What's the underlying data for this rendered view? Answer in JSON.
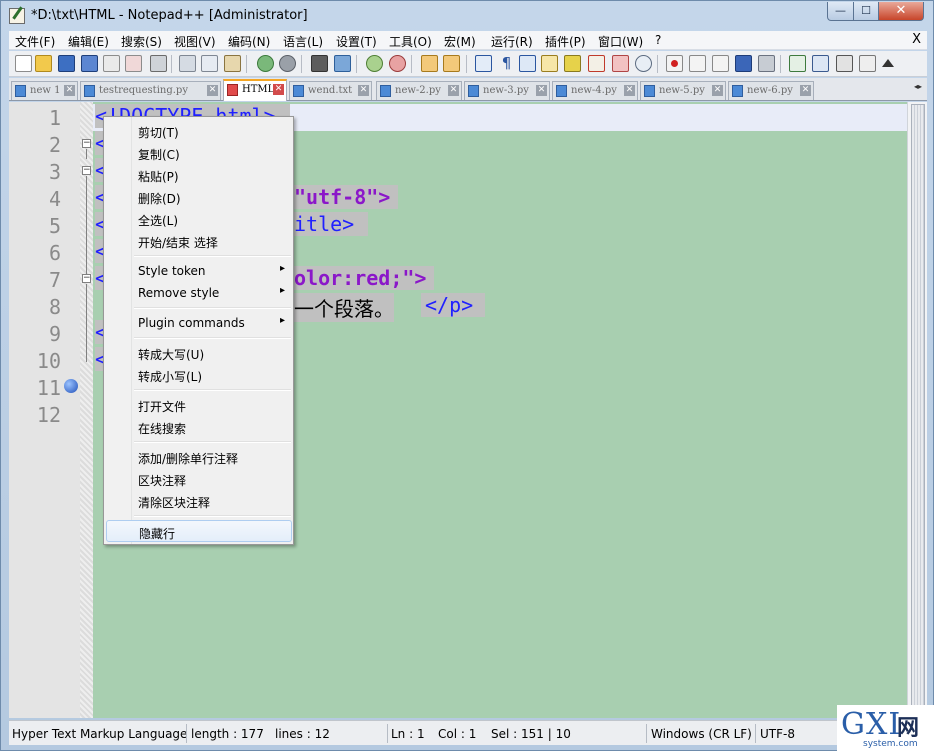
{
  "window": {
    "title": "*D:\\txt\\HTML - Notepad++ [Administrator]",
    "min_glyph": "—",
    "max_glyph": "☐",
    "close_glyph": "✕"
  },
  "menubar": {
    "items": [
      "文件(F)",
      "编辑(E)",
      "搜索(S)",
      "视图(V)",
      "编码(N)",
      "语言(L)",
      "设置(T)",
      "工具(O)",
      "宏(M)",
      "运行(R)",
      "插件(P)",
      "窗口(W)",
      "?"
    ],
    "close": "X"
  },
  "toolbar": {
    "icons": [
      "new-file-icon",
      "open-file-icon",
      "save-icon",
      "save-all-icon",
      "close-icon",
      "close-all-icon",
      "print-icon",
      "cut-icon",
      "copy-icon",
      "paste-icon",
      "undo-icon",
      "redo-icon",
      "find-icon",
      "replace-icon",
      "zoom-in-icon",
      "zoom-out-icon",
      "sync-vertical-icon",
      "sync-horizontal-icon",
      "word-wrap-icon",
      "show-all-chars-icon",
      "indent-guide-icon",
      "user-lang-icon",
      "doc-map-icon",
      "function-list-icon",
      "folder-icon",
      "monitor-icon",
      "record-macro-icon",
      "stop-record-icon",
      "play-macro-icon",
      "run-macro-multiple-icon",
      "save-macro-icon",
      "plugin-a-icon",
      "plugin-b-icon",
      "plugin-c-icon",
      "plugin-d-icon",
      "toolbar-up-icon"
    ]
  },
  "tabs": [
    {
      "label": "new 1",
      "active": false
    },
    {
      "label": "testrequesting.py",
      "active": false
    },
    {
      "label": "HTML",
      "active": true
    },
    {
      "label": "wend.txt",
      "active": false
    },
    {
      "label": "new-2.py",
      "active": false
    },
    {
      "label": "new-3.py",
      "active": false
    },
    {
      "label": "new-4.py",
      "active": false
    },
    {
      "label": "new-5.py",
      "active": false
    },
    {
      "label": "new-6.py",
      "active": false
    }
  ],
  "tab_close_glyph": "✕",
  "tab_scroll_glyph": "◂▸",
  "editor": {
    "line_numbers": [
      "1",
      "2",
      "3",
      "4",
      "5",
      "6",
      "7",
      "8",
      "9",
      "10",
      "11",
      "12"
    ],
    "line1_visible": "<!DOCTYPE html>",
    "line4_tail": "\"utf-8\">",
    "line5_tail": "itle>",
    "line7_tail": "olor:red;\">",
    "line8_text": "一个段落。",
    "line8_tag": "</p>",
    "gutter_lt": "<",
    "fold_glyph": "−"
  },
  "context_menu": {
    "items": [
      {
        "label": "剪切(T)",
        "submenu": false
      },
      {
        "label": "复制(C)",
        "submenu": false
      },
      {
        "label": "粘贴(P)",
        "submenu": false
      },
      {
        "label": "删除(D)",
        "submenu": false
      },
      {
        "label": "全选(L)",
        "submenu": false
      },
      {
        "label": "开始/结束 选择",
        "submenu": false
      },
      {
        "label": "Style token",
        "submenu": true
      },
      {
        "label": "Remove style",
        "submenu": true
      },
      {
        "label": "Plugin commands",
        "submenu": true
      },
      {
        "label": "转成大写(U)",
        "submenu": false
      },
      {
        "label": "转成小写(L)",
        "submenu": false
      },
      {
        "label": "打开文件",
        "submenu": false
      },
      {
        "label": "在线搜索",
        "submenu": false
      },
      {
        "label": "添加/删除单行注释",
        "submenu": false
      },
      {
        "label": "区块注释",
        "submenu": false
      },
      {
        "label": "清除区块注释",
        "submenu": false
      },
      {
        "label": "隐藏行",
        "submenu": false
      }
    ],
    "arrow_glyph": "▸"
  },
  "statusbar": {
    "language": "Hyper Text Markup Language",
    "length": "length : 177",
    "lines": "lines : 12",
    "ln": "Ln : 1",
    "col": "Col : 1",
    "sel": "Sel : 151 | 10",
    "eol": "Windows (CR LF)",
    "encoding": "UTF-8"
  },
  "watermark": {
    "brand": "GXI",
    "cn": "网",
    "url": "system.com"
  },
  "colors": {
    "editor_bg": "#a8cfb0",
    "tag": "#2020ff",
    "string": "#8b17c9",
    "selection": "#c0c0c0",
    "active_tab_accent": "#f5a623"
  }
}
